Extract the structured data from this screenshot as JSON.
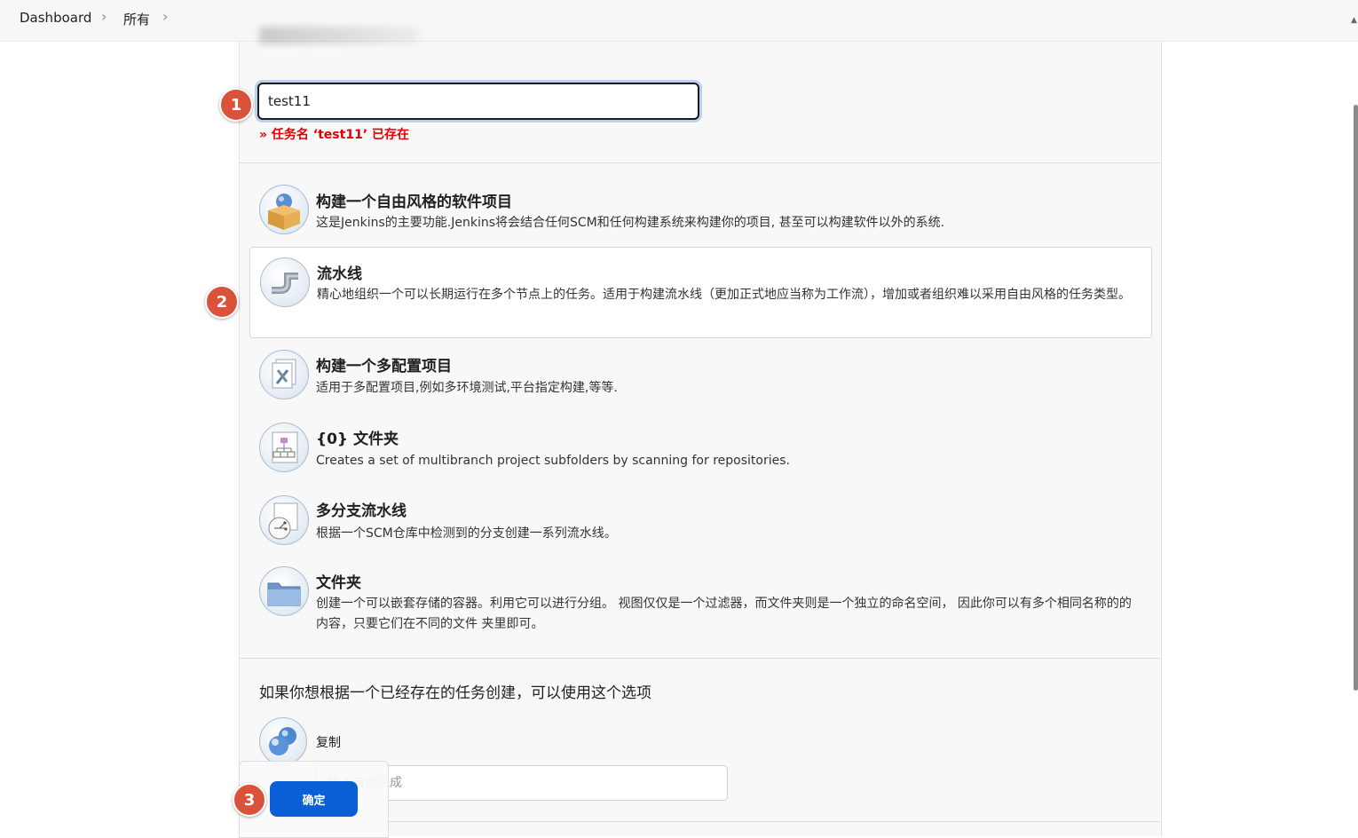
{
  "breadcrumb": {
    "items": [
      "Dashboard",
      "所有"
    ],
    "separator": "›"
  },
  "form": {
    "name_value": "test11",
    "error": "» 任务名 ‘test11’ 已存在"
  },
  "badges": [
    "1",
    "2",
    "3"
  ],
  "item_types": [
    {
      "title": "构建一个自由风格的软件项目",
      "desc": "这是Jenkins的主要功能.Jenkins将会结合任何SCM和任何构建系统来构建你的项目, 甚至可以构建软件以外的系统.",
      "icon": "freestyle-box-icon"
    },
    {
      "title": "流水线",
      "desc": "精心地组织一个可以长期运行在多个节点上的任务。适用于构建流水线（更加正式地应当称为工作流），增加或者组织难以采用自由风格的任务类型。",
      "icon": "pipeline-icon",
      "selected": true
    },
    {
      "title": "构建一个多配置项目",
      "desc": "适用于多配置项目,例如多环境测试,平台指定构建,等等.",
      "icon": "multi-config-icon"
    },
    {
      "title": "{0} 文件夹",
      "desc": "Creates a set of multibranch project subfolders by scanning for repositories.",
      "icon": "org-folder-icon"
    },
    {
      "title": "多分支流水线",
      "desc": "根据一个SCM仓库中检测到的分支创建一系列流水线。",
      "icon": "multibranch-icon"
    },
    {
      "title": "文件夹",
      "desc": "创建一个可以嵌套存储的容器。利用它可以进行分组。 视图仅仅是一个过滤器，而文件夹则是一个独立的命名空间， 因此你可以有多个相同名称的的内容，只要它们在不同的文件 夹里即可。",
      "icon": "folder-icon"
    }
  ],
  "copy": {
    "heading": "如果你想根据一个已经存在的任务创建，可以使用这个选项",
    "label": "复制",
    "placeholder": "输入自动完成"
  },
  "ok_button": "确定",
  "colors": {
    "accent": "#0b5fd6",
    "error": "#e00000",
    "badge": "#d9533a"
  }
}
